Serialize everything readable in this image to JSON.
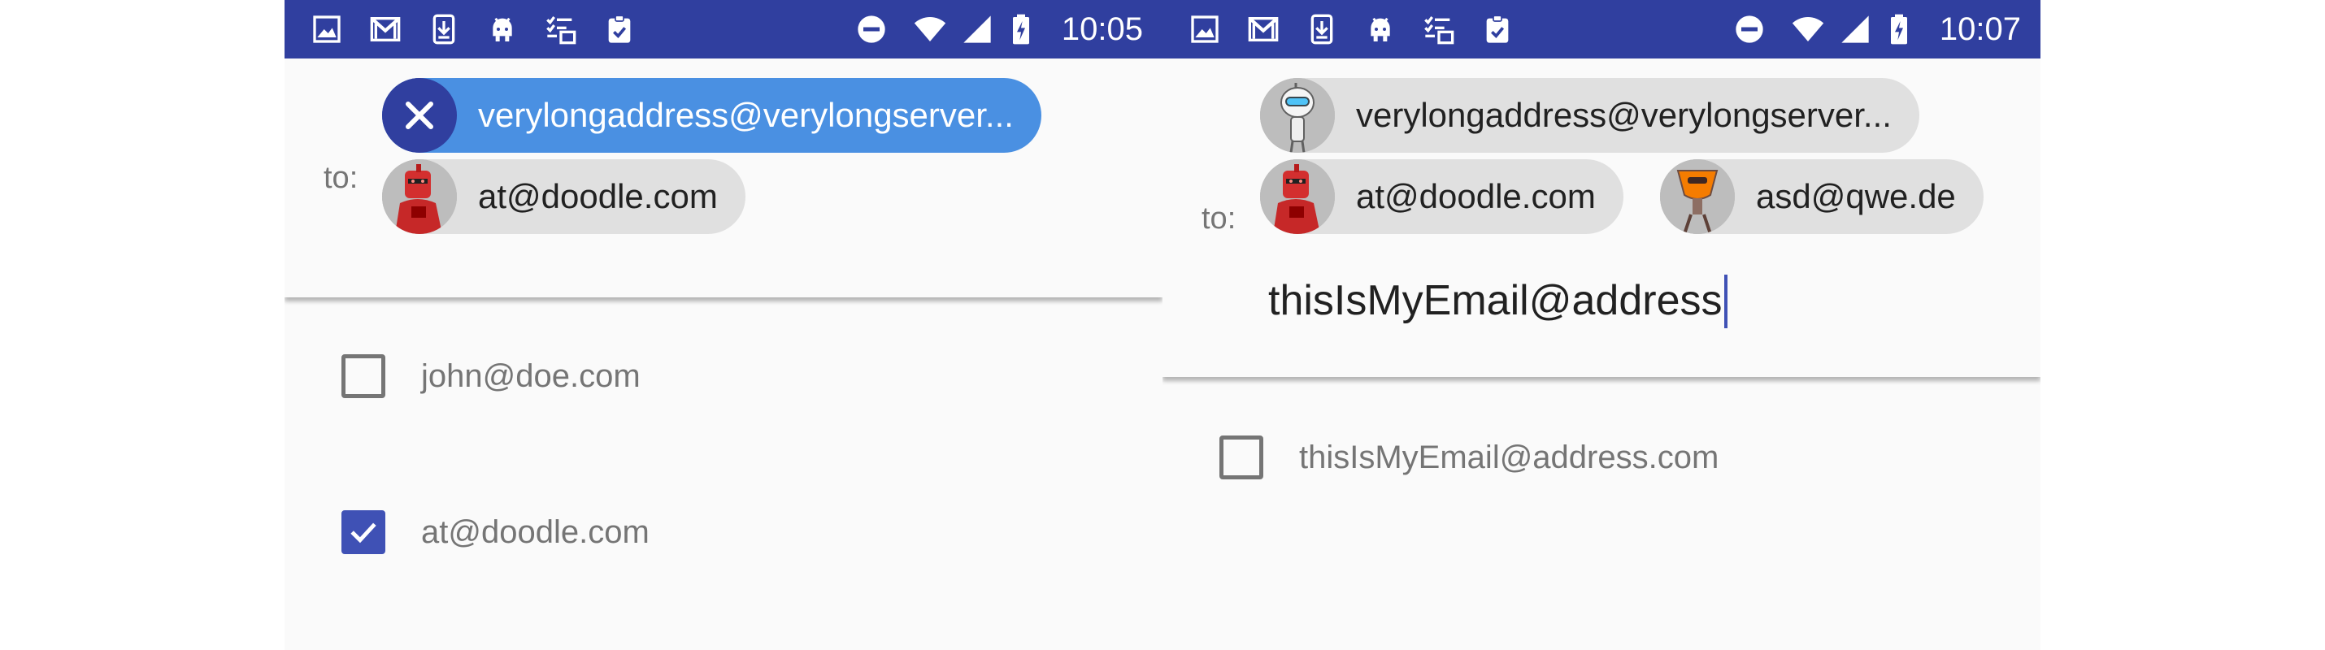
{
  "screens": [
    {
      "status_bar": {
        "time": "10:05",
        "notification_icons": [
          "image-icon",
          "gmail-icon",
          "download-icon",
          "android-icon",
          "checklist-icon",
          "clipboard-check-icon"
        ],
        "system_icons": [
          "do-not-disturb-icon",
          "wifi-icon",
          "cell-signal-icon",
          "battery-charging-icon"
        ]
      },
      "to_label": "to:",
      "chips": [
        {
          "text": "verylongaddress@verylongserver...",
          "selected": true,
          "leading": "close-icon"
        },
        {
          "text": "at@doodle.com",
          "selected": false,
          "leading": "red-robot-avatar"
        }
      ],
      "suggestions": [
        {
          "label": "john@doe.com",
          "checked": false
        },
        {
          "label": "at@doodle.com",
          "checked": true
        }
      ]
    },
    {
      "status_bar": {
        "time": "10:07",
        "notification_icons": [
          "image-icon",
          "gmail-icon",
          "download-icon",
          "android-icon",
          "checklist-icon",
          "clipboard-check-icon"
        ],
        "system_icons": [
          "do-not-disturb-icon",
          "wifi-icon",
          "cell-signal-icon",
          "battery-charging-icon"
        ]
      },
      "to_label": "to:",
      "chips": [
        {
          "text": "verylongaddress@verylongserver...",
          "selected": false,
          "leading": "white-robot-avatar"
        },
        {
          "text": "at@doodle.com",
          "selected": false,
          "leading": "red-robot-avatar"
        },
        {
          "text": "asd@qwe.de",
          "selected": false,
          "leading": "orange-robot-avatar"
        }
      ],
      "input_value": "thisIsMyEmail@address",
      "suggestions": [
        {
          "label": "thisIsMyEmail@address.com",
          "checked": false
        }
      ]
    }
  ],
  "colors": {
    "status_bar": "#303f9f",
    "selected_chip": "#4a90e2",
    "chip": "#e0e0e0",
    "accent": "#3f51b5"
  }
}
